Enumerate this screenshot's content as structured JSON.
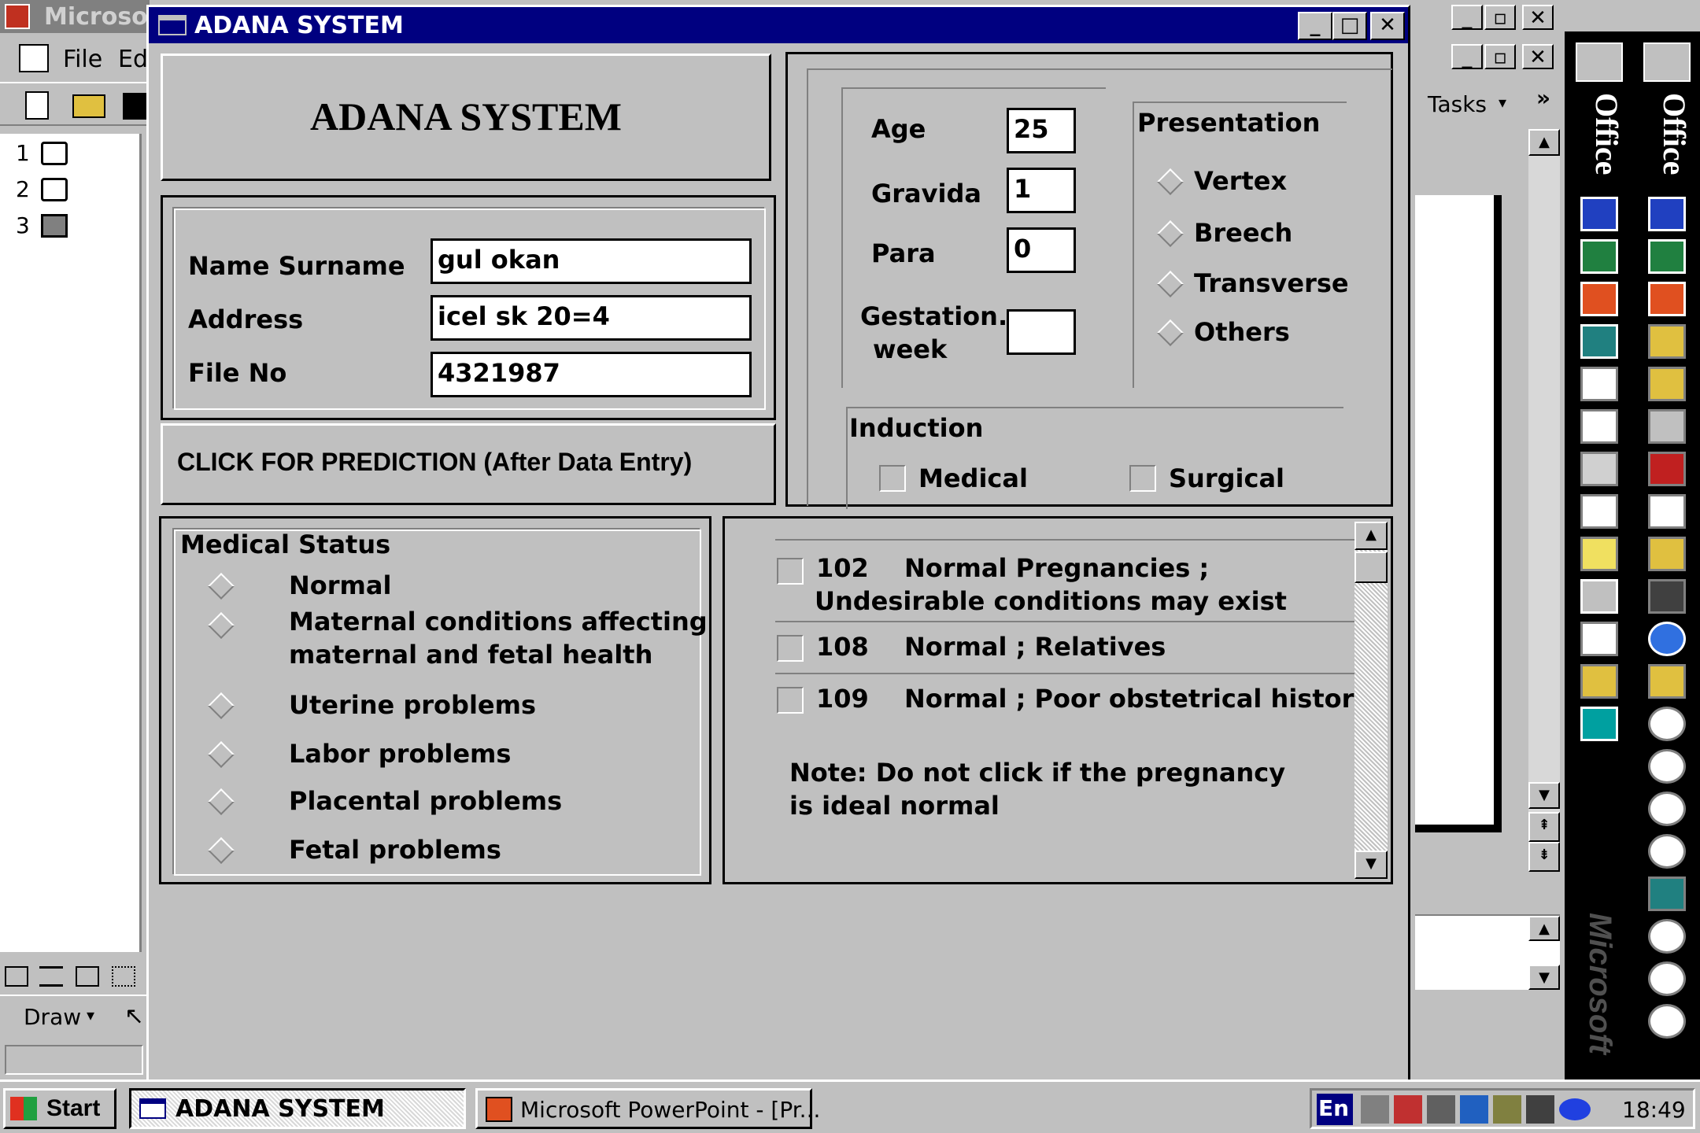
{
  "background_app": {
    "title": "Microsoft PowerPoint",
    "menu": [
      "File",
      "Edit"
    ],
    "slides": [
      "1",
      "2",
      "3"
    ],
    "draw_label": "Draw",
    "tasks_label": "Tasks"
  },
  "window": {
    "title": "ADANA SYSTEM",
    "controls": {
      "minimize": "_",
      "maximize": "□",
      "close": "✕"
    }
  },
  "header": {
    "banner": "ADANA SYSTEM"
  },
  "patient": {
    "name_label": "Name Surname",
    "name_value": "gul okan",
    "address_label": "Address",
    "address_value": "icel sk 20=4",
    "fileno_label": "File No",
    "fileno_value": "4321987"
  },
  "predict_button": "CLICK FOR PREDICTION (After Data Entry)",
  "obstetric": {
    "age_label": "Age",
    "age_value": "25",
    "gravida_label": "Gravida",
    "gravida_value": "1",
    "para_label": "Para",
    "para_value": "0",
    "gestation_label_1": "Gestation.",
    "gestation_label_2": "week",
    "gestation_value": ""
  },
  "presentation": {
    "title": "Presentation",
    "options": [
      "Vertex",
      "Breech",
      "Transverse",
      "Others"
    ]
  },
  "induction": {
    "title": "Induction",
    "options": [
      "Medical",
      "Surgical"
    ]
  },
  "medical_status": {
    "title": "Medical Status",
    "options": [
      "Normal",
      "Maternal conditions affecting",
      "maternal and fetal health",
      "Uterine problems",
      "Labor problems",
      "Placental problems",
      "Fetal problems"
    ]
  },
  "codes": [
    {
      "code": "102",
      "desc_1": "Normal Pregnancies ;",
      "desc_2": "Undesirable conditions may exist"
    },
    {
      "code": "108",
      "desc_1": "Normal ; Relatives"
    },
    {
      "code": "109",
      "desc_1": "Normal ; Poor obstetrical history"
    }
  ],
  "note": {
    "line1": "Note: Do not click if the pregnancy",
    "line2": "is ideal normal"
  },
  "office_bar": {
    "label": "Office",
    "brand": "Microsoft"
  },
  "taskbar": {
    "start": "Start",
    "tasks": [
      "ADANA SYSTEM",
      "Microsoft PowerPoint - [Pr..."
    ],
    "lang": "En",
    "clock": "18:49"
  },
  "colors": {
    "title_bar": "#000080",
    "face": "#c0c0c0",
    "office_bar": "#000000"
  }
}
